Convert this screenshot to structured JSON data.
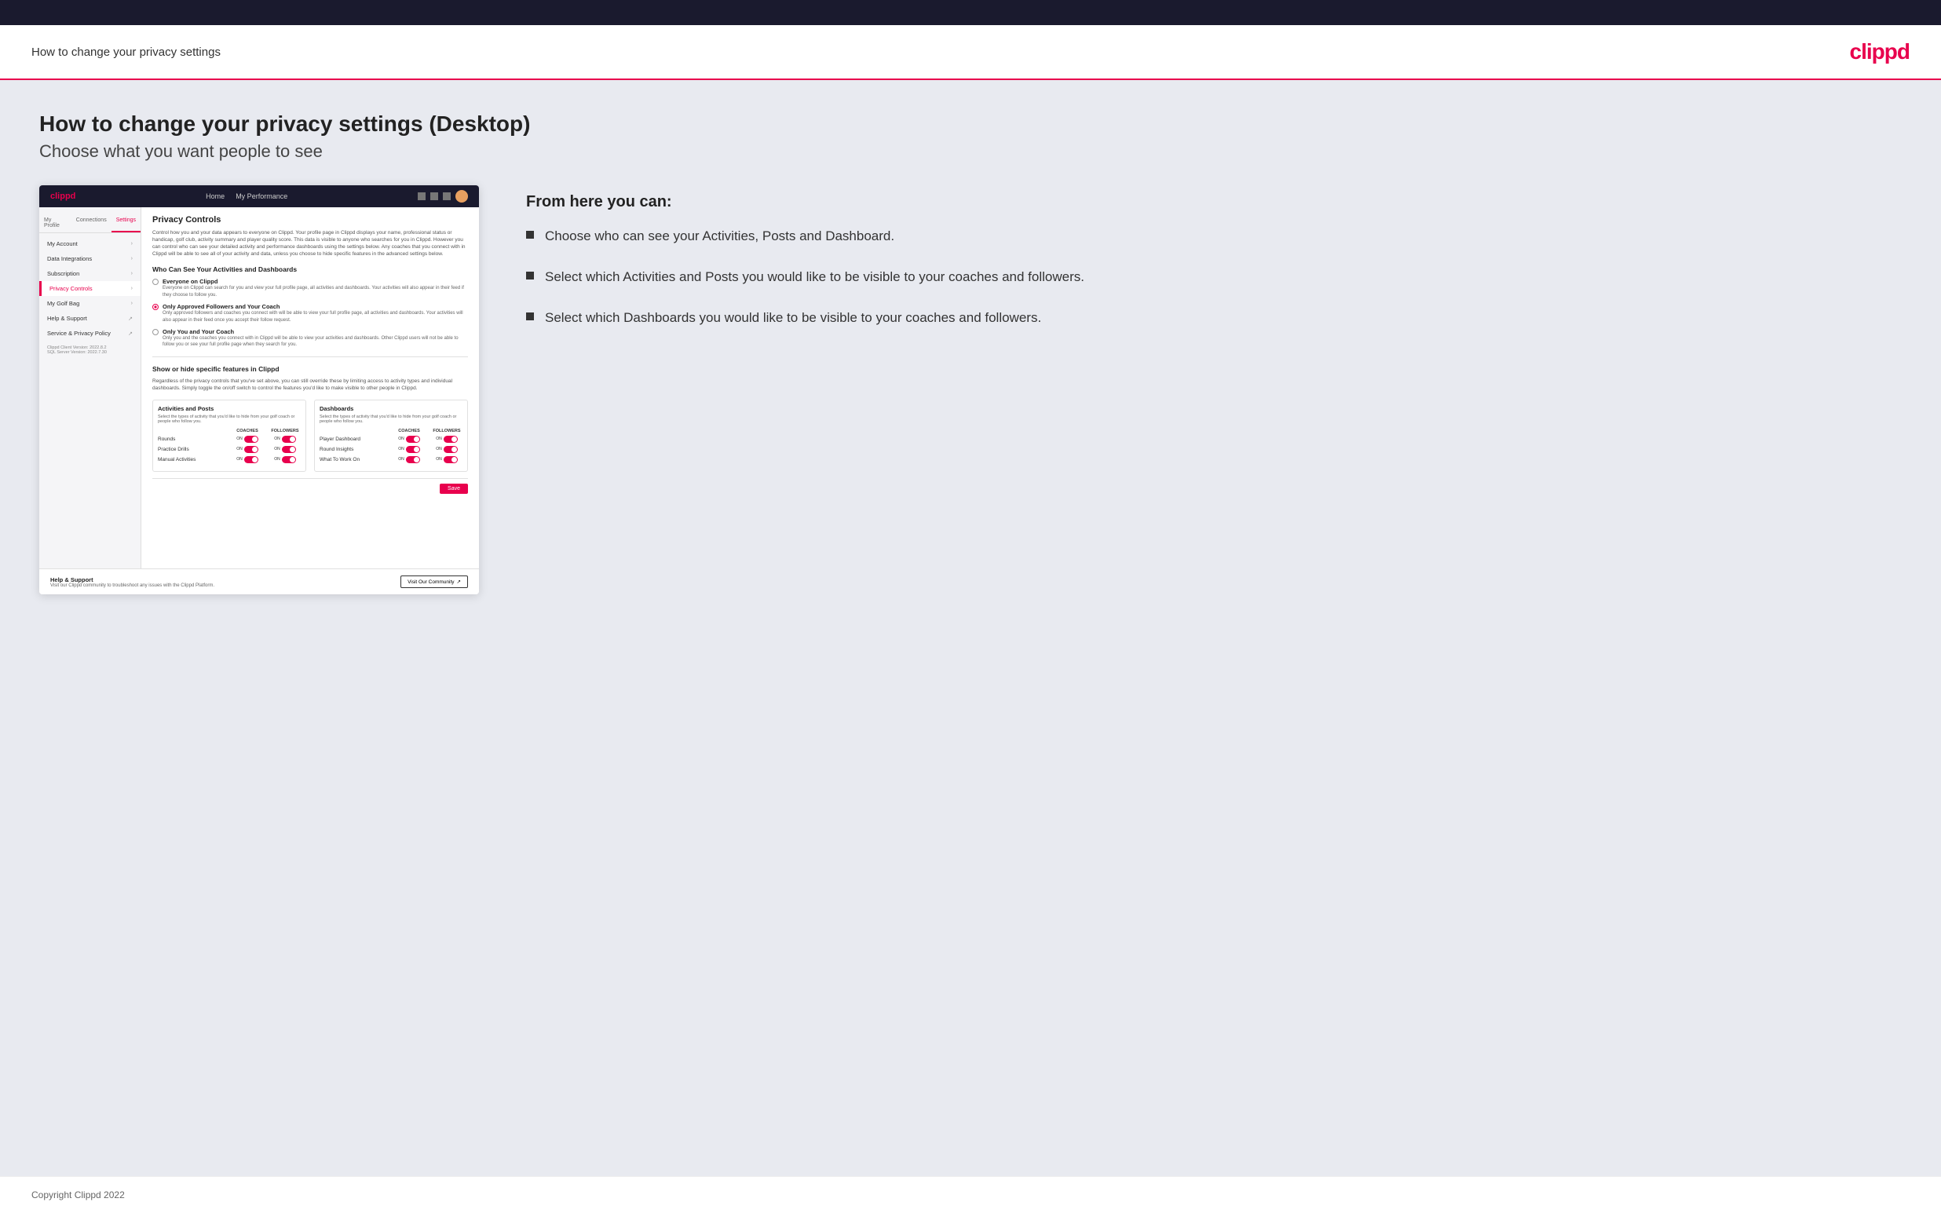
{
  "header": {
    "title": "How to change your privacy settings",
    "logo": "clippd"
  },
  "page": {
    "heading": "How to change your privacy settings (Desktop)",
    "subheading": "Choose what you want people to see"
  },
  "app_mockup": {
    "nav": {
      "logo": "clippd",
      "links": [
        "Home",
        "My Performance"
      ],
      "icons": [
        "search",
        "grid",
        "settings",
        "avatar"
      ]
    },
    "sidebar": {
      "tabs": [
        "My Profile",
        "Connections",
        "Settings"
      ],
      "active_tab": "Settings",
      "items": [
        {
          "label": "My Account",
          "active": false
        },
        {
          "label": "Data Integrations",
          "active": false
        },
        {
          "label": "Subscription",
          "active": false
        },
        {
          "label": "Privacy Controls",
          "active": true
        },
        {
          "label": "My Golf Bag",
          "active": false
        },
        {
          "label": "Help & Support",
          "active": false
        },
        {
          "label": "Service & Privacy Policy",
          "active": false
        }
      ]
    },
    "main": {
      "section_title": "Privacy Controls",
      "section_desc": "Control how you and your data appears to everyone on Clippd. Your profile page in Clippd displays your name, professional status or handicap, golf club, activity summary and player quality score. This data is visible to anyone who searches for you in Clippd. However you can control who can see your detailed activity and performance dashboards using the settings below. Any coaches that you connect with in Clippd will be able to see all of your activity and data, unless you choose to hide specific features in the advanced settings below.",
      "who_can_see_title": "Who Can See Your Activities and Dashboards",
      "radio_options": [
        {
          "label": "Everyone on Clippd",
          "desc": "Everyone on Clippd can search for you and view your full profile page, all activities and dashboards. Your activities will also appear in their feed if they choose to follow you.",
          "selected": false
        },
        {
          "label": "Only Approved Followers and Your Coach",
          "desc": "Only approved followers and coaches you connect with will be able to view your full profile page, all activities and dashboards. Your activities will also appear in their feed once you accept their follow request.",
          "selected": true
        },
        {
          "label": "Only You and Your Coach",
          "desc": "Only you and the coaches you connect with in Clippd will be able to view your activities and dashboards. Other Clippd users will not be able to follow you or see your full profile page when they search for you.",
          "selected": false
        }
      ],
      "show_hide_title": "Show or hide specific features in Clippd",
      "show_hide_desc": "Regardless of the privacy controls that you've set above, you can still override these by limiting access to activity types and individual dashboards. Simply toggle the on/off switch to control the features you'd like to make visible to other people in Clippd.",
      "activities_panel": {
        "title": "Activities and Posts",
        "desc": "Select the types of activity that you'd like to hide from your golf coach or people who follow you.",
        "col_labels": [
          "COACHES",
          "FOLLOWERS"
        ],
        "rows": [
          {
            "label": "Rounds",
            "coaches_on": true,
            "followers_on": true
          },
          {
            "label": "Practice Drills",
            "coaches_on": true,
            "followers_on": true
          },
          {
            "label": "Manual Activities",
            "coaches_on": true,
            "followers_on": true
          }
        ]
      },
      "dashboards_panel": {
        "title": "Dashboards",
        "desc": "Select the types of activity that you'd like to hide from your golf coach or people who follow you.",
        "col_labels": [
          "COACHES",
          "FOLLOWERS"
        ],
        "rows": [
          {
            "label": "Player Dashboard",
            "coaches_on": true,
            "followers_on": true
          },
          {
            "label": "Round Insights",
            "coaches_on": true,
            "followers_on": true
          },
          {
            "label": "What To Work On",
            "coaches_on": true,
            "followers_on": true
          }
        ]
      },
      "save_label": "Save"
    },
    "help": {
      "title": "Help & Support",
      "desc": "Visit our Clippd community to troubleshoot any issues with the Clippd Platform.",
      "button_label": "Visit Our Community"
    },
    "version": {
      "client": "Clippd Client Version: 2022.8.2",
      "sql": "SQL Server Version: 2022.7.30"
    }
  },
  "right_panel": {
    "from_here_title": "From here you can:",
    "bullets": [
      "Choose who can see your Activities, Posts and Dashboard.",
      "Select which Activities and Posts you would like to be visible to your coaches and followers.",
      "Select which Dashboards you would like to be visible to your coaches and followers."
    ]
  },
  "footer": {
    "copyright": "Copyright Clippd 2022"
  }
}
